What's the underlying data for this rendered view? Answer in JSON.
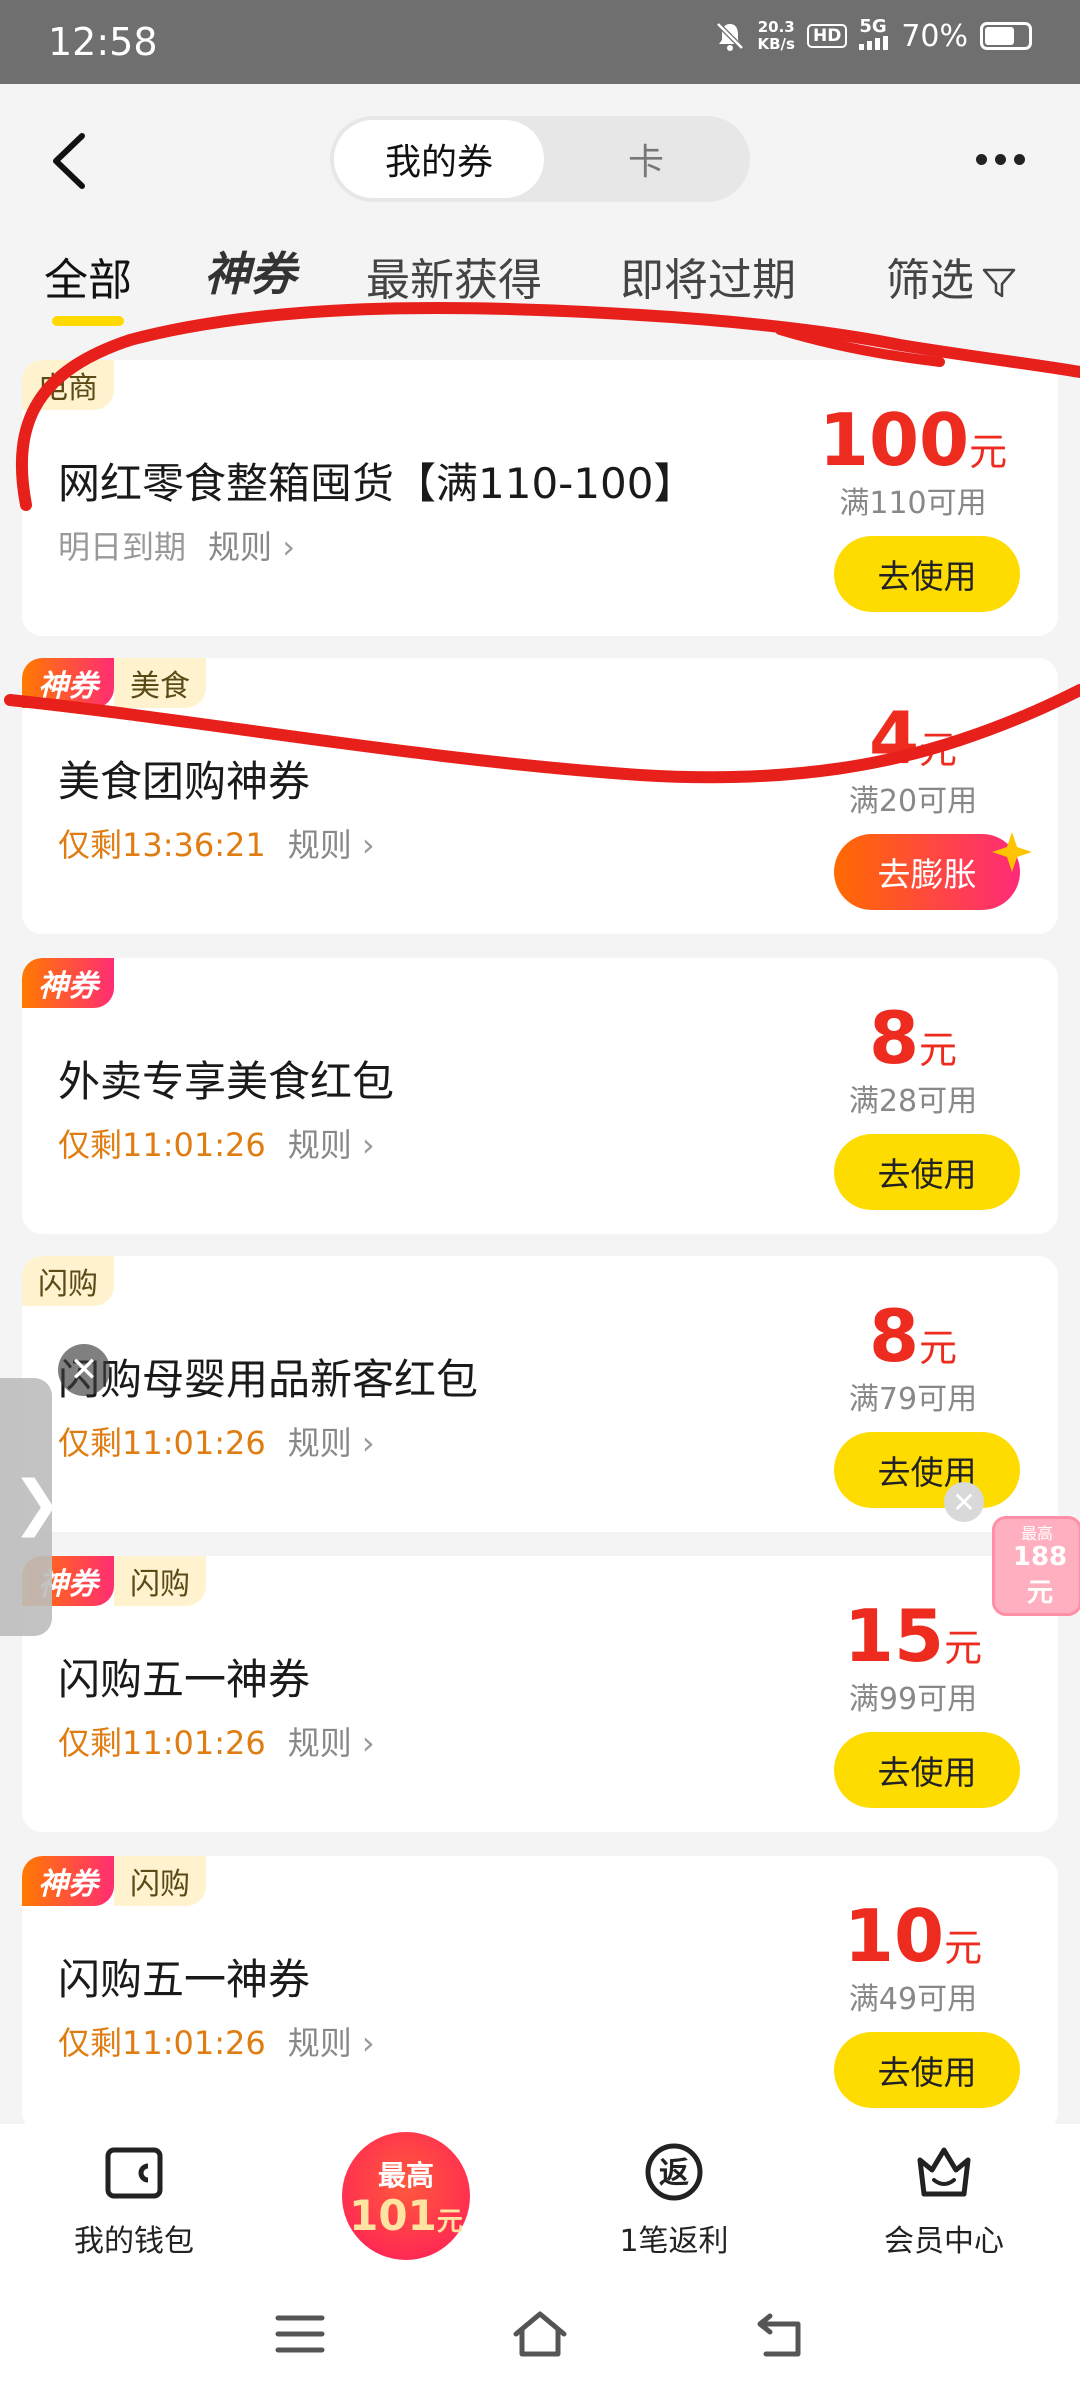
{
  "status": {
    "time": "12:58",
    "speed_top": "20.3",
    "speed_unit": "KB/s",
    "hd": "HD",
    "network": "5G",
    "battery": "70%",
    "battery_level": 0.7
  },
  "header": {
    "seg_active": "我的券",
    "seg_inactive": "卡"
  },
  "tabs": {
    "all": "全部",
    "shen": "神券",
    "newest": "最新获得",
    "expiring": "即将过期",
    "filter": "筛选"
  },
  "coupons": [
    {
      "tags": [
        "电商"
      ],
      "title": "网红零食整箱囤货【满110-100】",
      "expiry": "明日到期",
      "rules": "规则",
      "amount": "100",
      "unit": "元",
      "threshold": "满110可用",
      "button": "去使用"
    },
    {
      "tags": [
        "神券",
        "美食"
      ],
      "title": "美食团购神券",
      "expiry": "仅剩13:36:21",
      "rules": "规则",
      "amount": "4",
      "unit": "元",
      "threshold": "满20可用",
      "button": "去膨胀"
    },
    {
      "tags": [
        "神券"
      ],
      "title": "外卖专享美食红包",
      "expiry": "仅剩11:01:26",
      "rules": "规则",
      "amount": "8",
      "unit": "元",
      "threshold": "满28可用",
      "button": "去使用"
    },
    {
      "tags": [
        "闪购"
      ],
      "title": "闪购母婴用品新客红包",
      "expiry": "仅剩11:01:26",
      "rules": "规则",
      "amount": "8",
      "unit": "元",
      "threshold": "满79可用",
      "button": "去使用"
    },
    {
      "tags": [
        "神券",
        "闪购"
      ],
      "title": "闪购五一神券",
      "expiry": "仅剩11:01:26",
      "rules": "规则",
      "amount": "15",
      "unit": "元",
      "threshold": "满99可用",
      "button": "去使用"
    },
    {
      "tags": [
        "神券",
        "闪购"
      ],
      "title": "闪购五一神券",
      "expiry": "仅剩11:01:26",
      "rules": "规则",
      "amount": "10",
      "unit": "元",
      "threshold": "满49可用",
      "button": "去使用"
    }
  ],
  "float_badge": {
    "small": "最高",
    "big": "188元"
  },
  "bottom_nav": {
    "wallet": "我的钱包",
    "center_line1": "最高",
    "center_amount": "101",
    "center_unit": "元",
    "rebate_icon": "返",
    "rebate": "1笔返利",
    "member": "会员中心"
  },
  "colors": {
    "accent_yellow": "#ffdc00",
    "price_red": "#ee2b1f",
    "expiry_orange": "#e07d12",
    "annotation_red": "#e8201c"
  }
}
